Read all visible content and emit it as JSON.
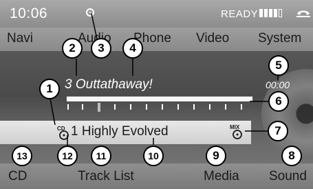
{
  "status_bar": {
    "time": "10:06",
    "status": "READY",
    "signal_level": 4,
    "signal_max": 5
  },
  "menu": [
    "Navi",
    "Audio",
    "Phone",
    "Video",
    "System"
  ],
  "track": {
    "title": "3 Outtathaway!",
    "time": "00:00"
  },
  "album": {
    "title": "1 Highly Evolved",
    "source_icon": "cd-icon",
    "mode_icon": "mix-icon",
    "cd_label": "CD",
    "mix_label": "MIX"
  },
  "bottom_menu": [
    "CD",
    "Track List",
    "Media",
    "Sound"
  ],
  "callouts": [
    "1",
    "2",
    "3",
    "4",
    "5",
    "6",
    "7",
    "8",
    "9",
    "10",
    "11",
    "12",
    "13"
  ],
  "colors": {
    "text": "#1a1a1a",
    "light_text": "#ffffff",
    "album_bar": "#dcdcdc"
  }
}
